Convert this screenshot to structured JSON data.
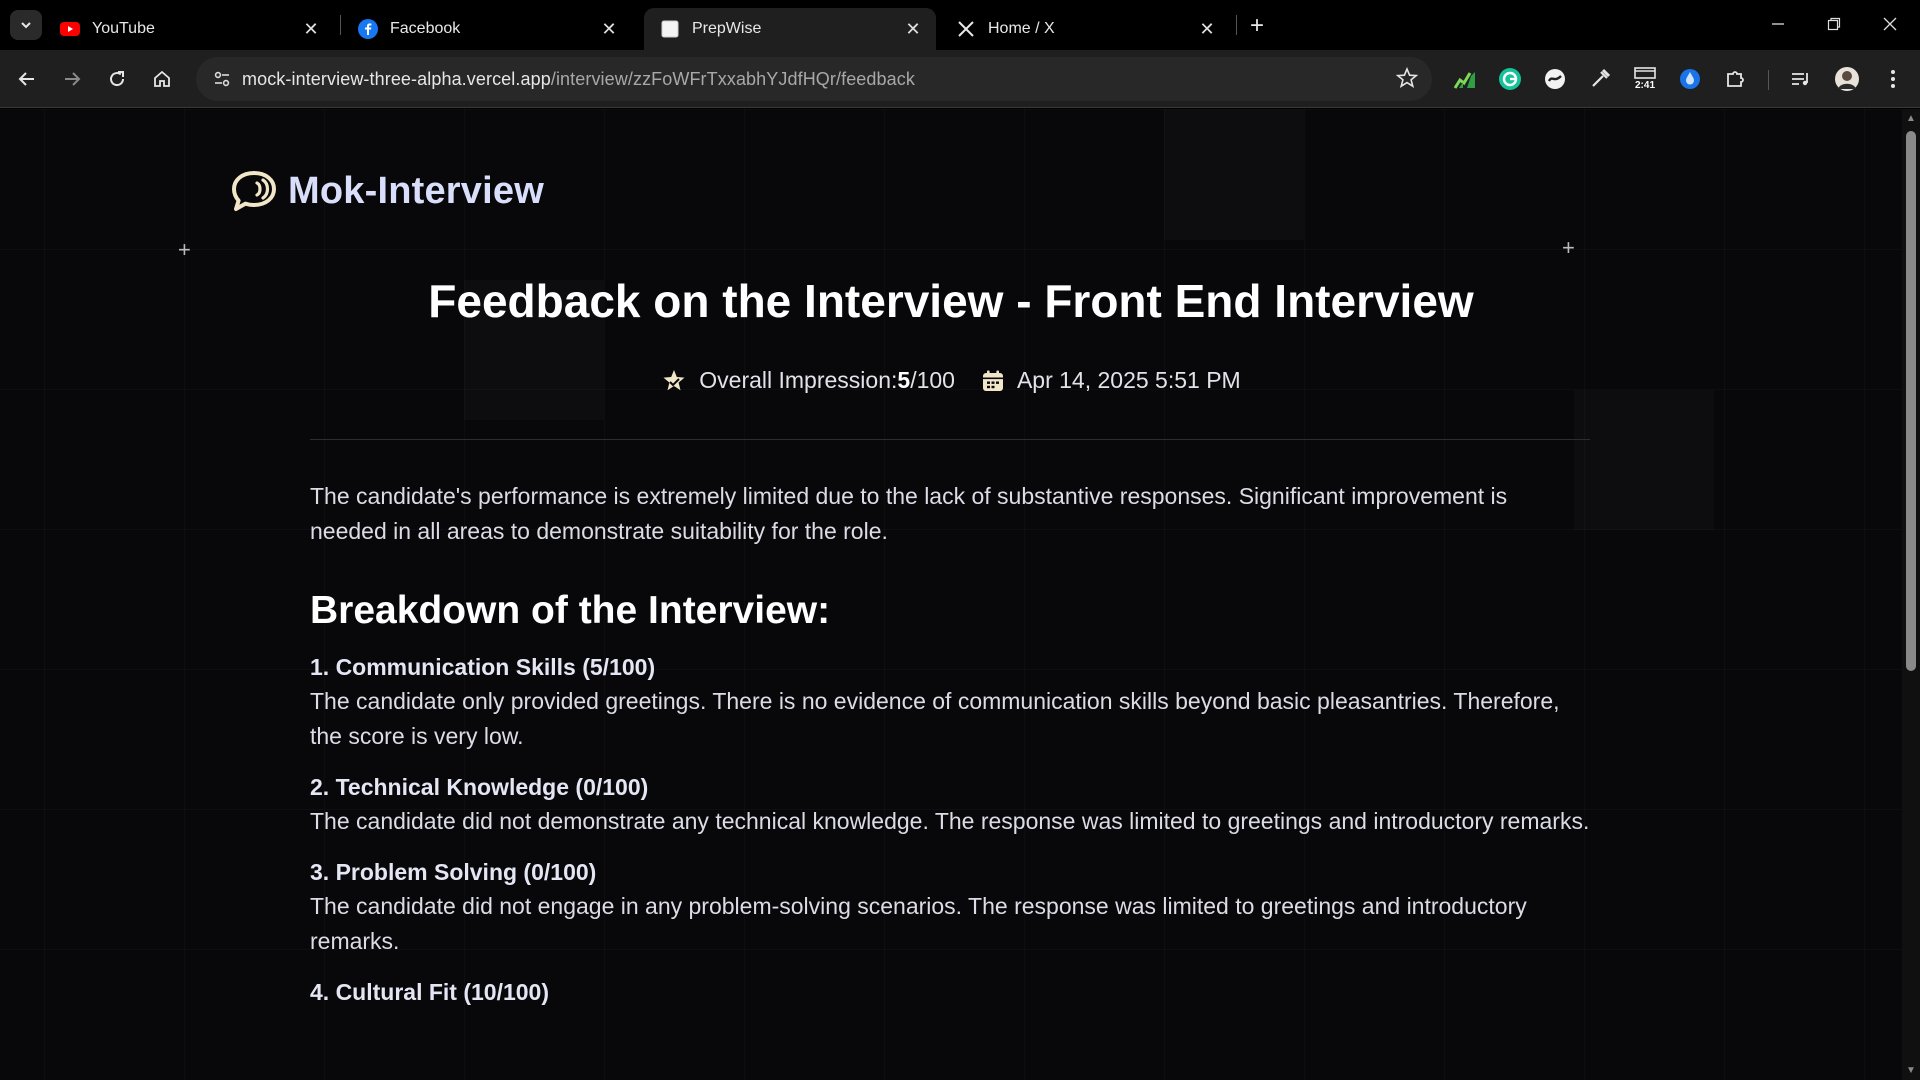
{
  "browser": {
    "tabs": [
      {
        "title": "YouTube",
        "favicon": "youtube-icon",
        "active": false
      },
      {
        "title": "Facebook",
        "favicon": "facebook-icon",
        "active": false
      },
      {
        "title": "PrepWise",
        "favicon": "page-icon",
        "active": true
      },
      {
        "title": "Home / X",
        "favicon": "x-icon",
        "active": false
      }
    ],
    "url_host": "mock-interview-three-alpha.vercel.app",
    "url_path": "/interview/zzFoWFrTxxabhYJdfHQr/feedback",
    "ext_badge": "2:41"
  },
  "app": {
    "logo_text": "Mok-Interview"
  },
  "feedback": {
    "title": "Feedback on the Interview - Front End Interview",
    "impression_label": "Overall Impression: ",
    "impression_score": "5",
    "impression_total": "/100",
    "date": "Apr 14, 2025 5:51 PM",
    "summary": "The candidate's performance is extremely limited due to the lack of substantive responses. Significant improvement is needed in all areas to demonstrate suitability for the role.",
    "breakdown_heading": "Breakdown of the Interview:",
    "categories": [
      {
        "title": "1. Communication Skills (5/100)",
        "text": "The candidate only provided greetings. There is no evidence of communication skills beyond basic pleasantries. Therefore, the score is very low."
      },
      {
        "title": "2. Technical Knowledge (0/100)",
        "text": "The candidate did not demonstrate any technical knowledge. The response was limited to greetings and introductory remarks."
      },
      {
        "title": "3. Problem Solving (0/100)",
        "text": "The candidate did not engage in any problem-solving scenarios. The response was limited to greetings and introductory remarks."
      },
      {
        "title": "4. Cultural Fit (10/100)",
        "text": ""
      }
    ]
  },
  "colors": {
    "page_bg": "#08080a",
    "logo": "#d9dffb",
    "accent_star": "#f2e6c9"
  }
}
